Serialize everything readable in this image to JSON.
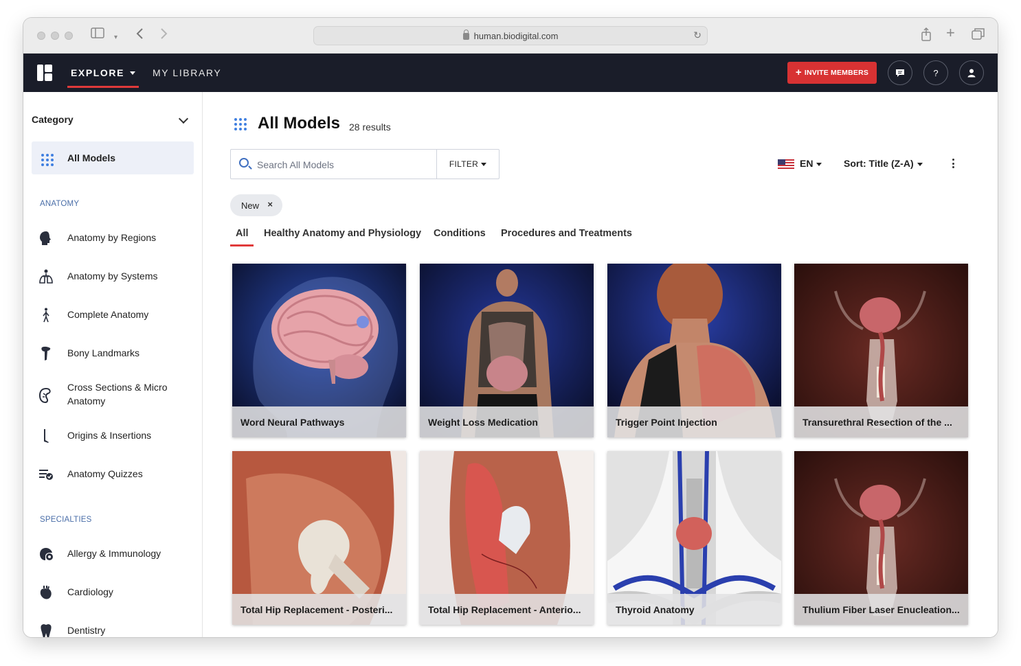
{
  "browser": {
    "url": "human.biodigital.com"
  },
  "header": {
    "explore_label": "EXPLORE",
    "library_label": "MY LIBRARY",
    "invite_label": "INVITE MEMBERS",
    "help_label": "?",
    "accent": "#d83233",
    "bg": "#1a1d29"
  },
  "sidebar": {
    "category_label": "Category",
    "all_models_label": "All Models",
    "anatomy_section": "ANATOMY",
    "anatomy_items": [
      {
        "label": "Anatomy by Regions",
        "icon": "head-icon"
      },
      {
        "label": "Anatomy by Systems",
        "icon": "lungs-icon"
      },
      {
        "label": "Complete Anatomy",
        "icon": "human-figure-icon"
      },
      {
        "label": "Bony Landmarks",
        "icon": "bone-icon"
      },
      {
        "label": "Cross Sections & Micro Anatomy",
        "icon": "kidney-icon"
      },
      {
        "label": "Origins & Insertions",
        "icon": "leg-bone-icon"
      },
      {
        "label": "Anatomy Quizzes",
        "icon": "quiz-icon"
      }
    ],
    "specialties_section": "SPECIALTIES",
    "specialty_items": [
      {
        "label": "Allergy & Immunology",
        "icon": "allergy-icon"
      },
      {
        "label": "Cardiology",
        "icon": "heart-icon"
      },
      {
        "label": "Dentistry",
        "icon": "tooth-icon"
      }
    ]
  },
  "main": {
    "title": "All Models",
    "results": "28 results",
    "search_placeholder": "Search All Models",
    "filter_label": "FILTER",
    "language": "EN",
    "sort_label": "Sort: Title (Z-A)",
    "chip_label": "New",
    "chip_close": "×",
    "tabs": [
      "All",
      "Healthy Anatomy and Physiology",
      "Conditions",
      "Procedures and Treatments"
    ],
    "cards": [
      {
        "title": "Word Neural Pathways"
      },
      {
        "title": "Weight Loss Medication"
      },
      {
        "title": "Trigger Point Injection"
      },
      {
        "title": "Transurethral Resection of the ..."
      },
      {
        "title": "Total Hip Replacement - Posteri..."
      },
      {
        "title": "Total Hip Replacement - Anterio..."
      },
      {
        "title": "Thyroid Anatomy"
      },
      {
        "title": "Thulium Fiber Laser Enucleation..."
      }
    ]
  }
}
